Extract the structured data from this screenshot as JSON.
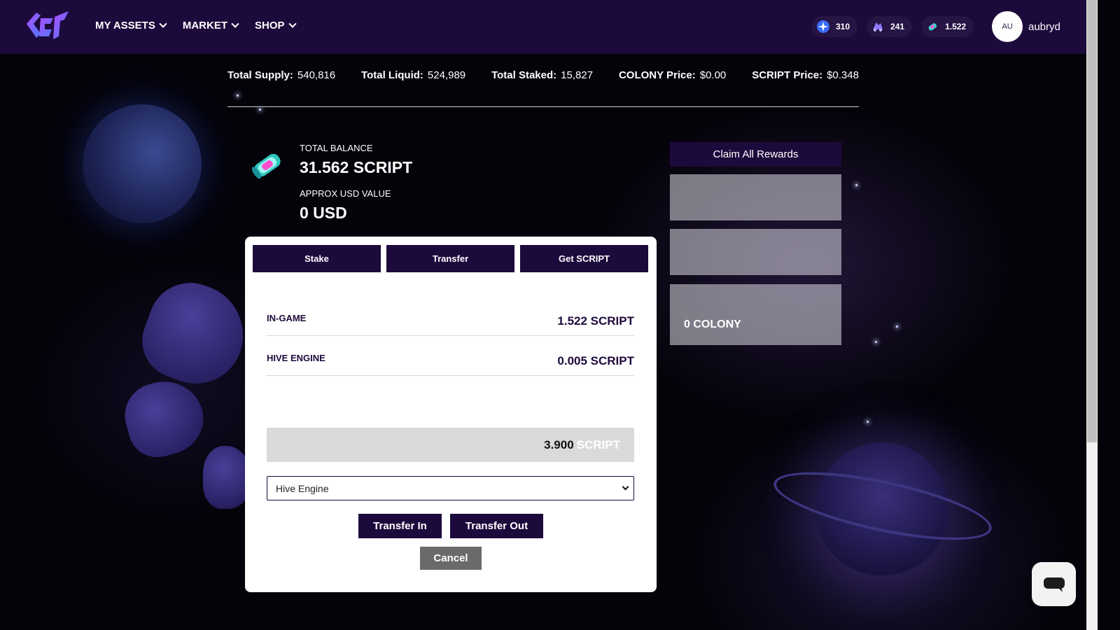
{
  "header": {
    "nav": [
      {
        "label": "MY ASSETS"
      },
      {
        "label": "MARKET"
      },
      {
        "label": "SHOP"
      }
    ],
    "balances": [
      {
        "icon": "star-token-icon",
        "value": "310"
      },
      {
        "icon": "colony-token-icon",
        "value": "241"
      },
      {
        "icon": "script-token-icon",
        "value": "1.522"
      }
    ],
    "avatar_initials": "AU",
    "username": "aubryd"
  },
  "stats": [
    {
      "label": "Total Supply:",
      "value": "540,816"
    },
    {
      "label": "Total Liquid:",
      "value": "524,989"
    },
    {
      "label": "Total Staked:",
      "value": "15,827"
    },
    {
      "label": "COLONY Price:",
      "value": "$0.00"
    },
    {
      "label": "SCRIPT Price:",
      "value": "$0.348"
    }
  ],
  "balance": {
    "total_label": "TOTAL BALANCE",
    "total_value": "31.562 SCRIPT",
    "usd_label": "APPROX USD VALUE",
    "usd_value": "0 USD"
  },
  "rewards": {
    "claim_label": "Claim All Rewards",
    "card3_value": "0 COLONY"
  },
  "modal": {
    "tabs": [
      {
        "label": "Stake"
      },
      {
        "label": "Transfer"
      },
      {
        "label": "Get SCRIPT"
      }
    ],
    "rows": [
      {
        "label": "IN-GAME",
        "value": "1.522 SCRIPT"
      },
      {
        "label": "HIVE ENGINE",
        "value": "0.005 SCRIPT"
      }
    ],
    "amount": {
      "value": "3.900",
      "unit": "SCRIPT"
    },
    "select_value": "Hive Engine",
    "transfer_in": "Transfer In",
    "transfer_out": "Transfer Out",
    "cancel": "Cancel"
  },
  "colors": {
    "brand_dark": "#1d0a3c",
    "header_bg": "#1d0a3c",
    "cancel_gray": "#6a6a6a"
  }
}
